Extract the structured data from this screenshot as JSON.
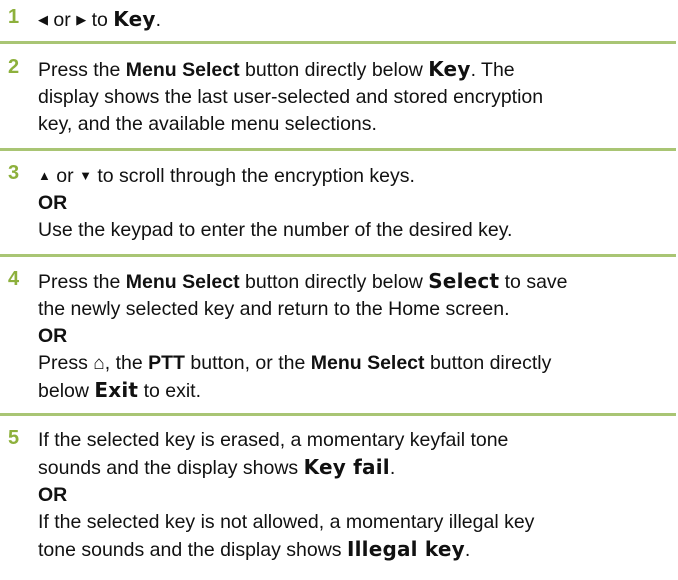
{
  "steps": [
    {
      "number": "1",
      "parts": [
        "◀",
        " or ",
        "▶",
        " to ",
        "Key",
        "."
      ]
    },
    {
      "number": "2",
      "parts": [
        "Press the ",
        "Menu Select",
        " button directly below ",
        "Key",
        ". The",
        "display shows the last user-selected and stored encryption",
        "key, and the available menu selections."
      ]
    },
    {
      "number": "3",
      "parts": [
        "▲",
        " or ",
        "▼",
        " to scroll through the encryption keys.",
        "OR",
        "Use the keypad to enter the number of the desired key."
      ]
    },
    {
      "number": "4",
      "parts": [
        "Press the ",
        "Menu Select",
        " button directly below ",
        "Select",
        " to save",
        "the newly selected key and return to the Home screen.",
        "OR",
        "Press ",
        "⌂",
        ", the ",
        "PTT",
        " button, or the ",
        "Menu Select",
        " button directly",
        "below ",
        "Exit",
        " to exit."
      ]
    },
    {
      "number": "5",
      "parts": [
        "If the selected key is erased, a momentary keyfail tone",
        "sounds and the display shows ",
        "Key fail",
        ".",
        "OR",
        "If the selected key is not allowed, a momentary illegal key",
        "tone sounds and the display shows ",
        "Illegal key",
        "."
      ]
    }
  ],
  "colors": {
    "step_number": "#8db03c",
    "rule": "#a9c574",
    "text": "#111111"
  }
}
